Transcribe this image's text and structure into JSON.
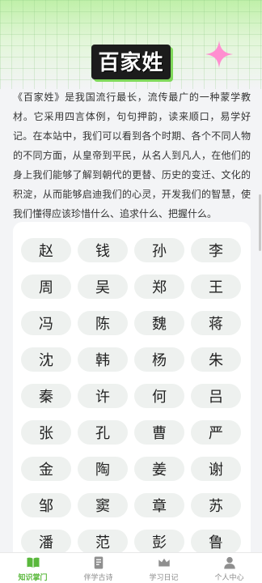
{
  "header": {
    "title": "百家姓"
  },
  "intro": {
    "text": "《百家姓》是我国流行最长，流传最广的一种蒙学教材。它采用四言体例，句句押韵，读来顺口，易学好记。在本站中，我们可以看到各个时期、各个不同人物的不同方面，从皇帝到平民，从名人到凡人，在他们的身上我们能够了解到朝代的更替、历史的变迁、文化的积淀，从而能够启迪我们的心灵，开发我们的智慧，使我们懂得应该珍惜什么、追求什么、把握什么。"
  },
  "surnames": [
    "赵",
    "钱",
    "孙",
    "李",
    "周",
    "吴",
    "郑",
    "王",
    "冯",
    "陈",
    "魏",
    "蒋",
    "沈",
    "韩",
    "杨",
    "朱",
    "秦",
    "许",
    "何",
    "吕",
    "张",
    "孔",
    "曹",
    "严",
    "金",
    "陶",
    "姜",
    "谢",
    "邹",
    "窦",
    "章",
    "苏",
    "潘",
    "范",
    "彭",
    "鲁"
  ],
  "tabs": [
    {
      "label": "知识掌门",
      "icon": "book-icon",
      "active": true
    },
    {
      "label": "伴学古诗",
      "icon": "scroll-icon",
      "active": false
    },
    {
      "label": "学习日记",
      "icon": "crown-icon",
      "active": false
    },
    {
      "label": "个人中心",
      "icon": "user-icon",
      "active": false
    }
  ],
  "colors": {
    "accent": "#5ab83c",
    "sparkle": "#ff8fd0",
    "title_bg": "#1c1c1c"
  }
}
